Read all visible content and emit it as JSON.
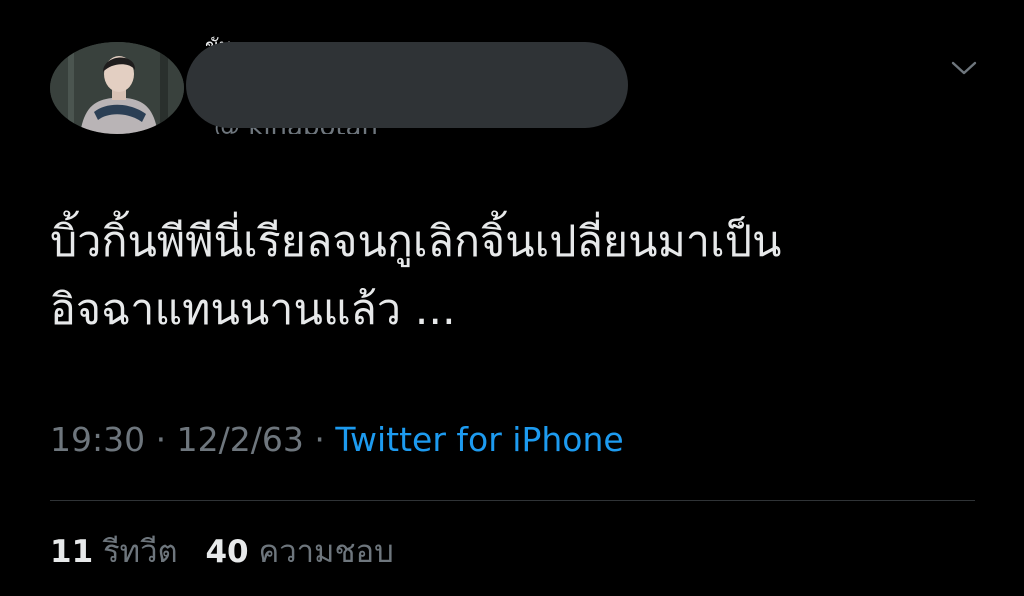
{
  "tweet": {
    "text": "บิ้วกิ้นพีพีนี่เรียลจนกูเลิกจิ้นเปลี่ยนมาเป็น\nอิจฉาแทนนานแล้ว ...",
    "time": "19:30",
    "separator": "·",
    "date": "12/2/63",
    "source": "Twitter for iPhone",
    "author": {
      "name_peek": "ขั้น",
      "handle_peek": "@ kinabotan"
    }
  },
  "stats": {
    "retweets_count": "11",
    "retweets_label": "รีทวีต",
    "likes_count": "40",
    "likes_label": "ความชอบ"
  },
  "icons": {
    "menu": "chevron-down-icon"
  },
  "colors": {
    "background": "#000000",
    "text": "#e7e9ea",
    "muted": "#6e767d",
    "link": "#1d9bf0",
    "redaction": "#2f3336"
  }
}
